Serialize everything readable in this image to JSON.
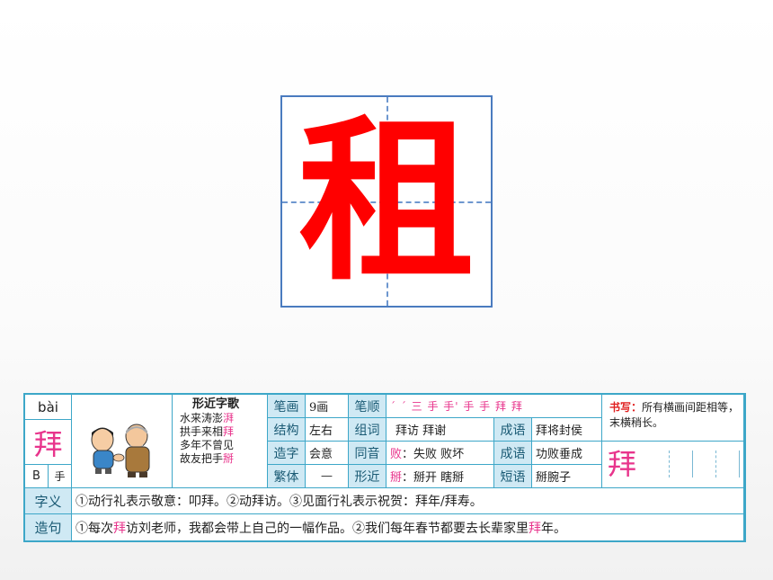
{
  "main_char": "租",
  "card": {
    "pinyin": "bài",
    "char": "拜",
    "radical_letter": "B",
    "radical": "手",
    "poem_title": "形近字歌",
    "poem_lines": [
      {
        "text": "水来涛澎",
        "hl": "湃"
      },
      {
        "text": "拱手来相",
        "hl": "拜"
      },
      {
        "text": "多年不曾见",
        "hl": ""
      },
      {
        "text": "故友把手",
        "hl": "掰"
      }
    ],
    "labels": {
      "strokes": "笔画",
      "order": "笔顺",
      "structure": "结构",
      "words": "组词",
      "idiom": "成语",
      "formation": "造字",
      "homophone": "同音",
      "traditional": "繁体",
      "similar": "形近",
      "phrase": "短语",
      "meaning": "字义",
      "sentence": "造句"
    },
    "stroke_count": "9画",
    "stroke_order": "ˊ ˊ 三 手 手' 手 手 拜 拜",
    "structure_val": "左右",
    "words_val": "拜访   拜谢",
    "idiom1": "拜将封侯",
    "formation_val": "会意",
    "homophone_hl": "败",
    "homophone_rest": "：失败   败坏",
    "idiom2": "功败垂成",
    "traditional_val": "—",
    "similar_hl": "掰",
    "similar_rest": "：掰开   瞎掰",
    "phrase_val": "掰腕子",
    "writing_tip_label": "书写：",
    "writing_tip": "所有横画间距相等，末横稍长。",
    "meaning_text": "①动行礼表示敬意：叩拜。②动拜访。③见面行礼表示祝贺：拜年/拜寿。",
    "sentence_parts": [
      {
        "t": "①每次"
      },
      {
        "t": "拜",
        "hl": true
      },
      {
        "t": "访刘老师，我都会带上自己的一幅作品。②我们每年春节都要去长辈家里"
      },
      {
        "t": "拜",
        "hl": true
      },
      {
        "t": "年。"
      }
    ]
  },
  "colors": {
    "main": "#ff0000",
    "accent": "#e8348c",
    "border": "#3da7c8",
    "label_bg": "#cfe9f4"
  }
}
